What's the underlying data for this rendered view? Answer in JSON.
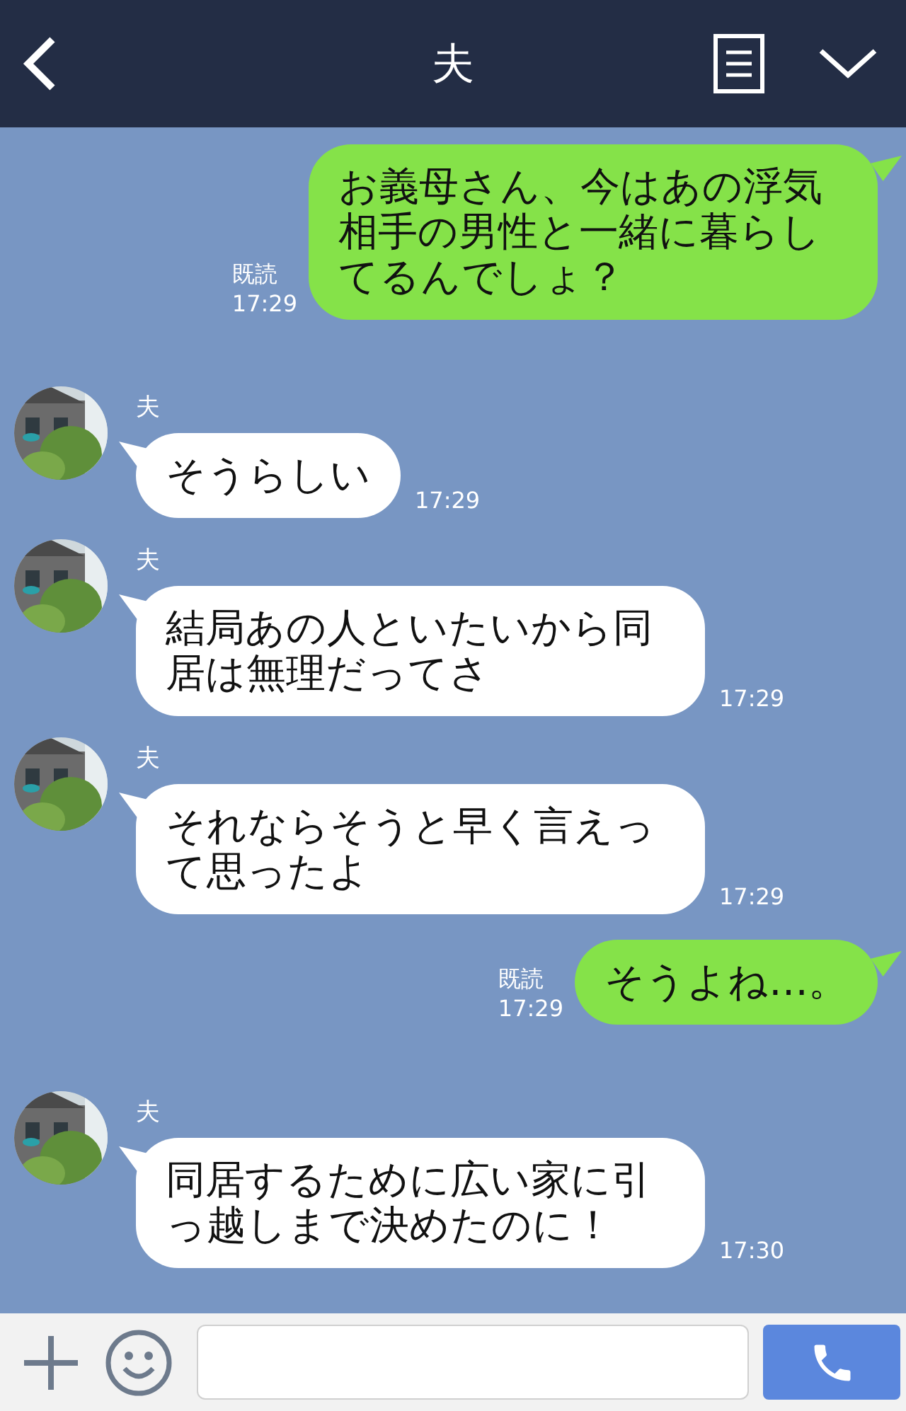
{
  "header": {
    "title": "夫"
  },
  "messages": [
    {
      "kind": "outgoing",
      "text": "お義母さん、今はあの浮気相手の男性と一緒に暮らしてるんでしょ？",
      "read": "既読",
      "time": "17:29"
    },
    {
      "kind": "incoming",
      "sender": "夫",
      "text": "そうらしい",
      "time": "17:29"
    },
    {
      "kind": "incoming",
      "sender": "夫",
      "text": "結局あの人といたいから同居は無理だってさ",
      "time": "17:29"
    },
    {
      "kind": "incoming",
      "sender": "夫",
      "text": "それならそうと早く言えって思ったよ",
      "time": "17:29"
    },
    {
      "kind": "outgoing",
      "text": "そうよね…。",
      "read": "既読",
      "time": "17:29"
    },
    {
      "kind": "incoming",
      "sender": "夫",
      "text": "同居するために広い家に引っ越しまで決めたのに！",
      "time": "17:30"
    }
  ]
}
